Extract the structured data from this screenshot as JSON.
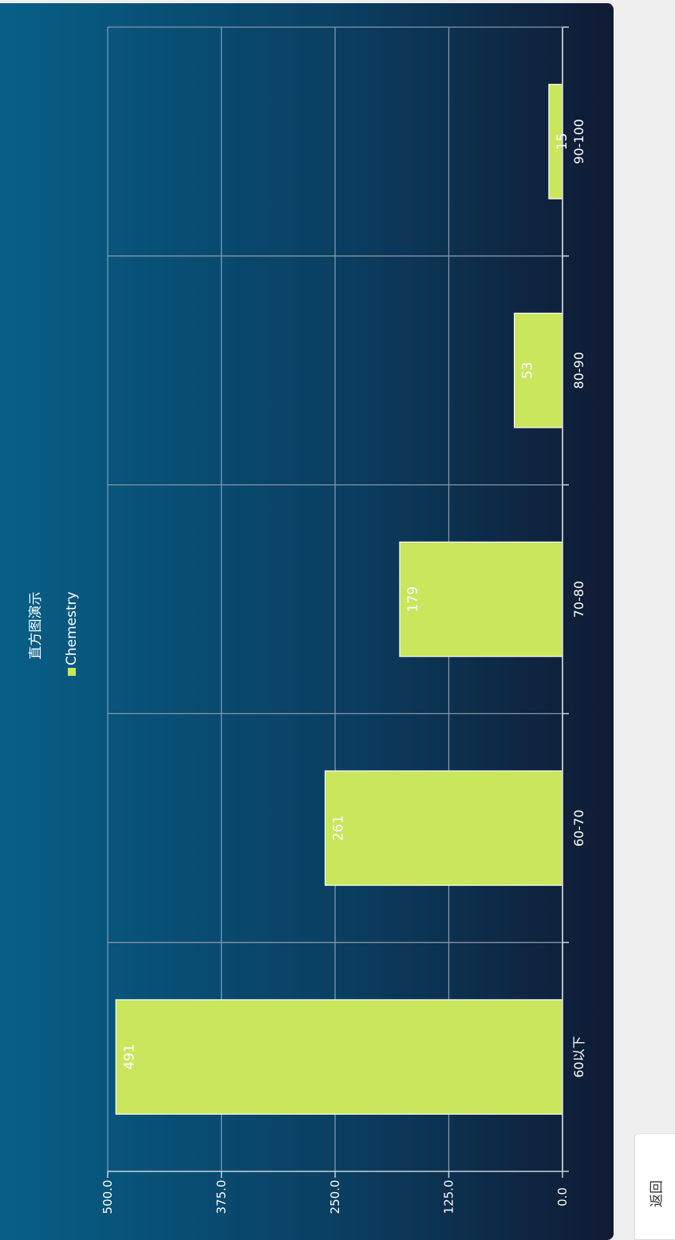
{
  "chart_data": {
    "type": "bar",
    "title": "直方图演示",
    "categories": [
      "60以下",
      "60-70",
      "70-80",
      "80-90",
      "90-100"
    ],
    "series": [
      {
        "name": "Chemestry",
        "values": [
          491,
          261,
          179,
          53,
          15
        ],
        "color": "#c9e65d"
      }
    ],
    "ylim": [
      0,
      500
    ],
    "yticks": [
      "0.0",
      "125.0",
      "250.0",
      "375.0",
      "500.0"
    ],
    "grid": true,
    "legend_position": "top",
    "orientation": "rotated"
  },
  "colors": {
    "bar": "#c9e65d",
    "background_start": "#075f87",
    "background_end": "#101a33"
  },
  "back_button": {
    "label": "返回"
  }
}
